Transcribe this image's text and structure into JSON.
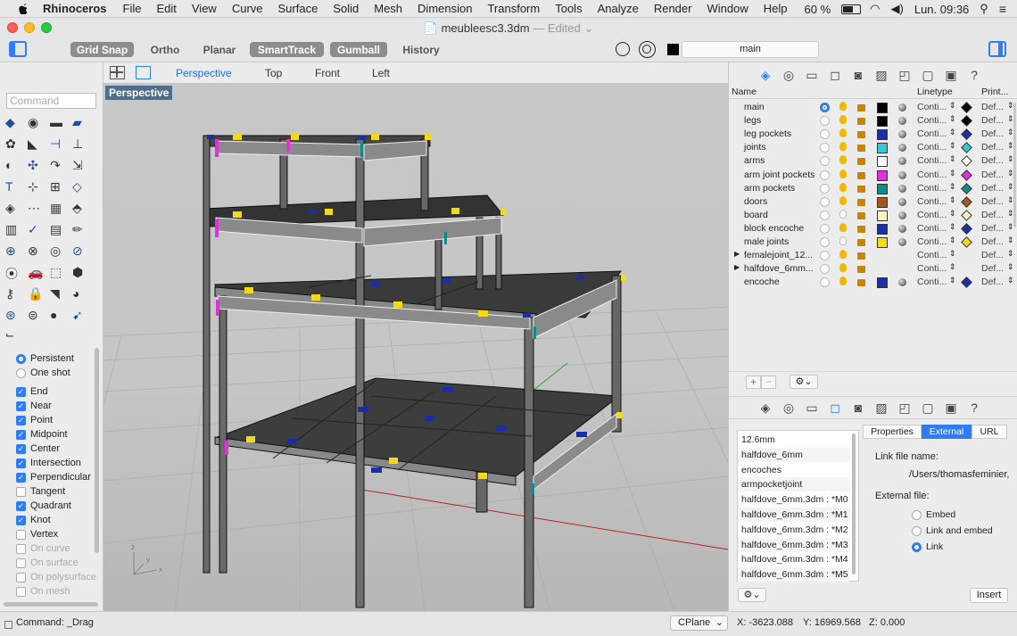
{
  "menubar": {
    "app": "Rhinoceros",
    "items": [
      "File",
      "Edit",
      "View",
      "Curve",
      "Surface",
      "Solid",
      "Mesh",
      "Dimension",
      "Transform",
      "Tools",
      "Analyze",
      "Render",
      "Window",
      "Help"
    ],
    "battery": "60 %",
    "clock": "Lun. 09:36"
  },
  "window": {
    "title": "meubleesc3.3dm",
    "edited": "— Edited"
  },
  "toolbar": {
    "grid_snap": "Grid Snap",
    "ortho": "Ortho",
    "planar": "Planar",
    "smarttrack": "SmartTrack",
    "gumball": "Gumball",
    "history": "History",
    "layer": "main"
  },
  "command": {
    "placeholder": "Command"
  },
  "osnap": {
    "persistent": "Persistent",
    "one_shot": "One shot",
    "items": [
      {
        "label": "End",
        "checked": true
      },
      {
        "label": "Near",
        "checked": true
      },
      {
        "label": "Point",
        "checked": true
      },
      {
        "label": "Midpoint",
        "checked": true
      },
      {
        "label": "Center",
        "checked": true
      },
      {
        "label": "Intersection",
        "checked": true
      },
      {
        "label": "Perpendicular",
        "checked": true
      },
      {
        "label": "Tangent",
        "checked": false
      },
      {
        "label": "Quadrant",
        "checked": true
      },
      {
        "label": "Knot",
        "checked": true
      },
      {
        "label": "Vertex",
        "checked": false
      },
      {
        "label": "On curve",
        "checked": false
      },
      {
        "label": "On surface",
        "checked": false
      },
      {
        "label": "On polysurface",
        "checked": false
      },
      {
        "label": "On mesh",
        "checked": false
      }
    ]
  },
  "viewport": {
    "tabs": [
      "Perspective",
      "Top",
      "Front",
      "Left"
    ],
    "label": "Perspective"
  },
  "layers": {
    "col_name": "Name",
    "col_linetype": "Linetype",
    "col_print": "Print...",
    "rows": [
      {
        "name": "main",
        "color": "#000000",
        "print": "#000000",
        "linetype": "Conti...",
        "printwidth": "Def...",
        "current": true
      },
      {
        "name": "legs",
        "color": "#000000",
        "print": "#000000",
        "linetype": "Conti...",
        "printwidth": "Def..."
      },
      {
        "name": "leg pockets",
        "color": "#1a2eaa",
        "print": "#1a2eaa",
        "linetype": "Conti...",
        "printwidth": "Def..."
      },
      {
        "name": "joints",
        "color": "#33c9d6",
        "print": "#33c9d6",
        "linetype": "Conti...",
        "printwidth": "Def..."
      },
      {
        "name": "arms",
        "color": "#ffffff",
        "print": "#ffffff",
        "linetype": "Conti...",
        "printwidth": "Def..."
      },
      {
        "name": "arm joint pockets",
        "color": "#e22ee0",
        "print": "#e22ee0",
        "linetype": "Conti...",
        "printwidth": "Def..."
      },
      {
        "name": "arm pockets",
        "color": "#0e8c8c",
        "print": "#0e8c8c",
        "linetype": "Conti...",
        "printwidth": "Def..."
      },
      {
        "name": "doors",
        "color": "#a8561a",
        "print": "#a8561a",
        "linetype": "Conti...",
        "printwidth": "Def..."
      },
      {
        "name": "board",
        "color": "#fff4bf",
        "print": "#fff4bf",
        "linetype": "Conti...",
        "printwidth": "Def..."
      },
      {
        "name": "block encoche",
        "color": "#1a2eaa",
        "print": "#1a2eaa",
        "linetype": "Conti...",
        "printwidth": "Def..."
      },
      {
        "name": "male joints",
        "color": "#f2d91a",
        "print": "#f2d91a",
        "linetype": "Conti...",
        "printwidth": "Def..."
      },
      {
        "name": "femalejoint_12...",
        "color": "",
        "print": "",
        "linetype": "Conti...",
        "printwidth": "Def...",
        "group": true
      },
      {
        "name": "halfdove_6mm...",
        "color": "",
        "print": "",
        "linetype": "Conti...",
        "printwidth": "Def...",
        "group": true
      },
      {
        "name": "encoche",
        "color": "#1a2eaa",
        "print": "#1a2eaa",
        "linetype": "Conti...",
        "printwidth": "Def..."
      }
    ]
  },
  "blocks": {
    "items": [
      "12.6mm",
      "halfdove_6mm",
      "encoches",
      "armpocketjoint",
      "halfdove_6mm.3dm : *M0",
      "halfdove_6mm.3dm : *M1",
      "halfdove_6mm.3dm : *M2",
      "halfdove_6mm.3dm : *M3",
      "halfdove_6mm.3dm : *M4",
      "halfdove_6mm.3dm : *M5"
    ],
    "tabs": [
      "Properties",
      "External",
      "URL"
    ],
    "link_file_label": "Link file name:",
    "link_file_value": "/Users/thomasfeminier,",
    "external_file_label": "External file:",
    "embed": "Embed",
    "link_and_embed": "Link and embed",
    "link": "Link",
    "insert": "Insert"
  },
  "status": {
    "command": "Command: _Drag",
    "cplane": "CPlane",
    "x": "X: -3623.088",
    "y": "Y: 16969.568",
    "z": "Z: 0.000"
  }
}
